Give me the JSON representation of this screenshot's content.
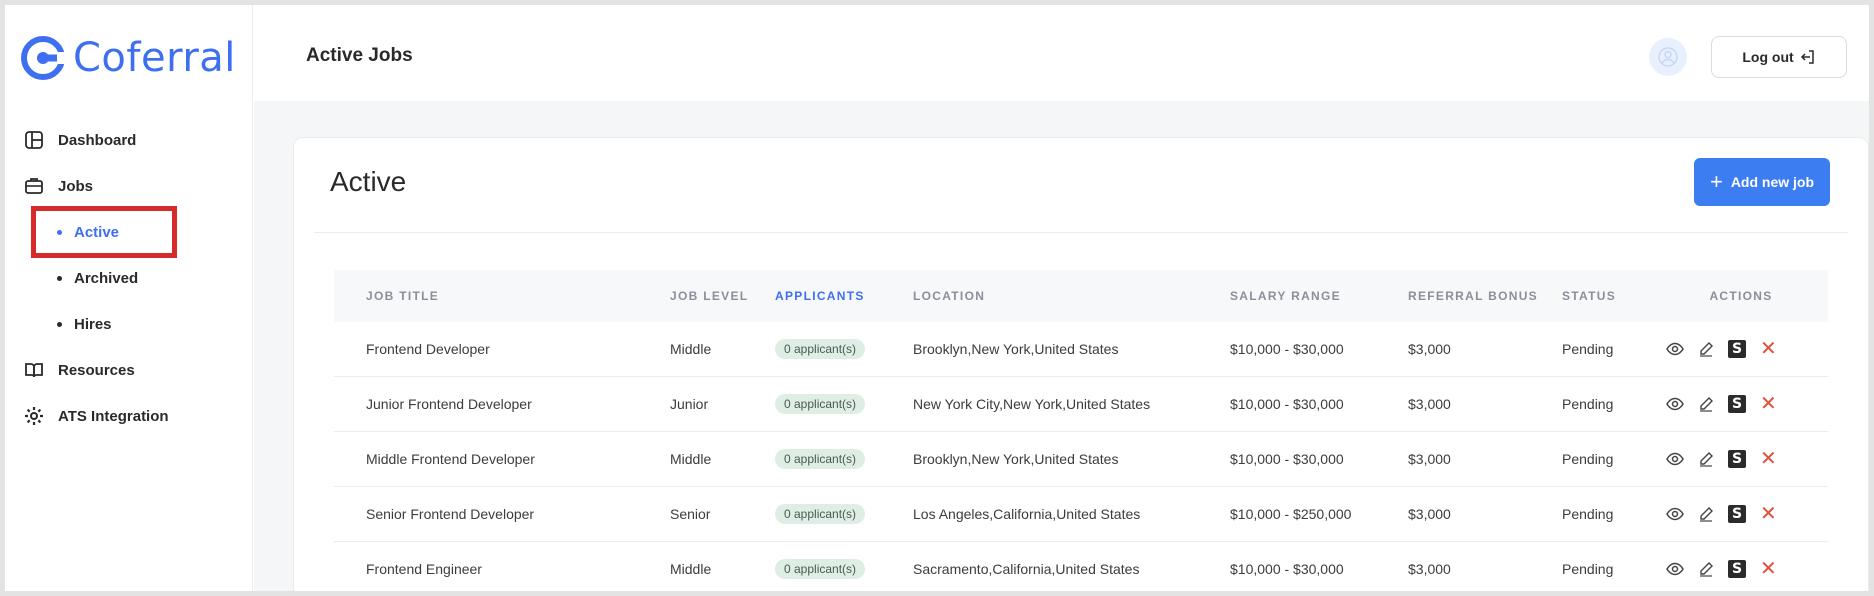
{
  "brand": {
    "name": "Coferral",
    "color": "#3d6ff0"
  },
  "sidebar": {
    "items": [
      {
        "label": "Dashboard",
        "icon": "dashboard-icon"
      },
      {
        "label": "Jobs",
        "icon": "briefcase-icon"
      },
      {
        "label": "Active",
        "sub": true,
        "active": true
      },
      {
        "label": "Archived",
        "sub": true
      },
      {
        "label": "Hires",
        "sub": true
      },
      {
        "label": "Resources",
        "icon": "book-icon"
      },
      {
        "label": "ATS Integration",
        "icon": "gear-icon"
      }
    ]
  },
  "header": {
    "title": "Active Jobs",
    "logout_label": "Log out"
  },
  "main": {
    "title": "Active",
    "add_button_label": "Add new job",
    "accent": "#3d7df2",
    "table": {
      "columns": [
        "JOB TITLE",
        "JOB LEVEL",
        "APPLICANTS",
        "LOCATION",
        "SALARY RANGE",
        "REFERRAL BONUS",
        "STATUS",
        "ACTIONS"
      ],
      "rows": [
        {
          "title": "Frontend Developer",
          "level": "Middle",
          "applicants": "0 applicant(s)",
          "location": "Brooklyn,New York,United States",
          "salary": "$10,000 - $30,000",
          "bonus": "$3,000",
          "status": "Pending"
        },
        {
          "title": "Junior Frontend Developer",
          "level": "Junior",
          "applicants": "0 applicant(s)",
          "location": "New York City,New York,United States",
          "salary": "$10,000 - $30,000",
          "bonus": "$3,000",
          "status": "Pending"
        },
        {
          "title": "Middle Frontend Developer",
          "level": "Middle",
          "applicants": "0 applicant(s)",
          "location": "Brooklyn,New York,United States",
          "salary": "$10,000 - $30,000",
          "bonus": "$3,000",
          "status": "Pending"
        },
        {
          "title": "Senior Frontend Developer",
          "level": "Senior",
          "applicants": "0 applicant(s)",
          "location": "Los Angeles,California,United States",
          "salary": "$10,000 - $250,000",
          "bonus": "$3,000",
          "status": "Pending"
        },
        {
          "title": "Frontend Engineer",
          "level": "Middle",
          "applicants": "0 applicant(s)",
          "location": "Sacramento,California,United States",
          "salary": "$10,000 - $30,000",
          "bonus": "$3,000",
          "status": "Pending"
        }
      ]
    }
  },
  "actions_icons": [
    "eye-icon",
    "pencil-icon",
    "s-icon",
    "close-icon"
  ],
  "s_icon_glyph": "S",
  "close_glyph": "✕"
}
